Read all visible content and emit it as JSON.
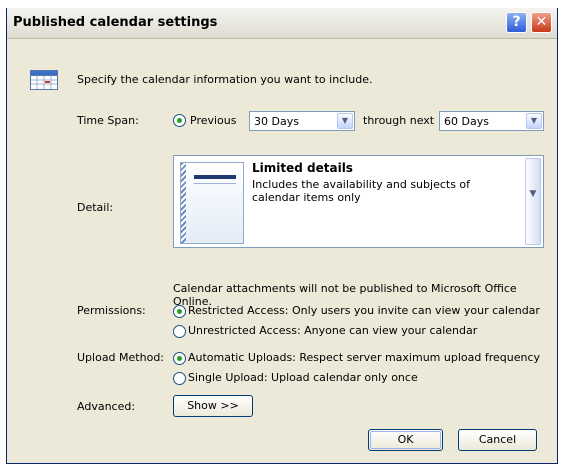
{
  "window": {
    "title": "Published calendar settings",
    "help_label": "?",
    "close_label": "✕"
  },
  "intro": "Specify the calendar information you want to include.",
  "time_span": {
    "label": "Time Span:",
    "previous_label": "Previous",
    "previous_value": "30 Days",
    "through_next_label": "through next",
    "next_value": "60 Days"
  },
  "detail": {
    "label": "Detail:",
    "title": "Limited details",
    "description": "Includes the availability and subjects of calendar items only"
  },
  "attachments_note": "Calendar attachments will not be published to Microsoft Office Online.",
  "permissions": {
    "label": "Permissions:",
    "options": [
      {
        "label": "Restricted Access: Only users you invite can view your calendar",
        "selected": true
      },
      {
        "label": "Unrestricted Access: Anyone can view your calendar",
        "selected": false
      }
    ]
  },
  "upload_method": {
    "label": "Upload Method:",
    "options": [
      {
        "label": "Automatic Uploads: Respect server maximum upload frequency",
        "selected": true
      },
      {
        "label": "Single Upload: Upload calendar only once",
        "selected": false
      }
    ]
  },
  "advanced": {
    "label": "Advanced:",
    "button": "Show >>"
  },
  "buttons": {
    "ok": "OK",
    "cancel": "Cancel"
  },
  "icons": {
    "calendar": "calendar-icon",
    "dropdown": "chevron-down-icon"
  },
  "colors": {
    "dialog_bg": "#ece9d8",
    "radio_selected": "#21a121",
    "close_button": "#c8381a",
    "help_button": "#2c5cd8"
  }
}
